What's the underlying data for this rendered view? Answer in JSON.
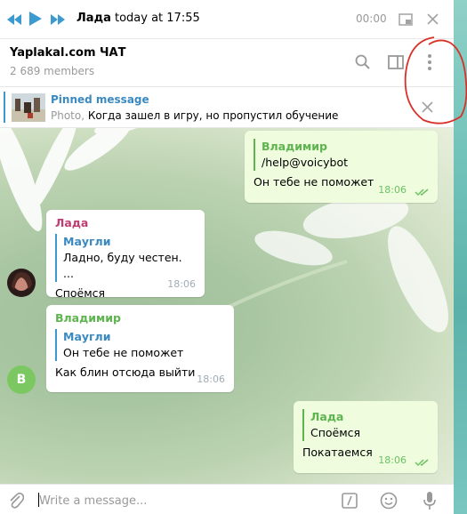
{
  "player": {
    "title_name": "Лада",
    "title_time": "today at 17:55",
    "time": "00:00"
  },
  "header": {
    "chat_title": "Yaplakal.com ЧАТ",
    "members": "2 689 members"
  },
  "pinned": {
    "title": "Pinned message",
    "kind": "Photo,",
    "text": " Когда зашел в игру, но пропустил обучение"
  },
  "messages": [
    {
      "reply_name": "Владимир",
      "reply_text": "/help@voicybot",
      "text": "Он тебе не поможет",
      "time": "18:06"
    },
    {
      "sender": "Лада",
      "reply_name": "Маугли",
      "reply_text": "Ладно, буду честен. ...",
      "text": "Споёмся",
      "time": "18:06"
    },
    {
      "sender": "Владимир",
      "avatar_letter": "В",
      "reply_name": "Маугли",
      "reply_text": "Он тебе не поможет",
      "text": "Как блин отсюда выйти",
      "time": "18:06"
    },
    {
      "reply_name": "Лада",
      "reply_text": "Споёмся",
      "text": "Покатаемся",
      "time": "18:06"
    }
  ],
  "composer": {
    "placeholder": "Write a message..."
  },
  "colors": {
    "accent": "#3d9ad0",
    "outgoing_bubble": "#effdde",
    "green_name": "#5eb44f",
    "pink_name": "#c03d73",
    "annotation": "#d9302a"
  },
  "icons": [
    "prev-icon",
    "play-icon",
    "next-icon",
    "pip-icon",
    "close-icon",
    "search-icon",
    "columns-icon",
    "more-vert-icon",
    "attach-icon",
    "commands-icon",
    "emoji-icon",
    "mic-icon",
    "read-ticks-icon"
  ]
}
